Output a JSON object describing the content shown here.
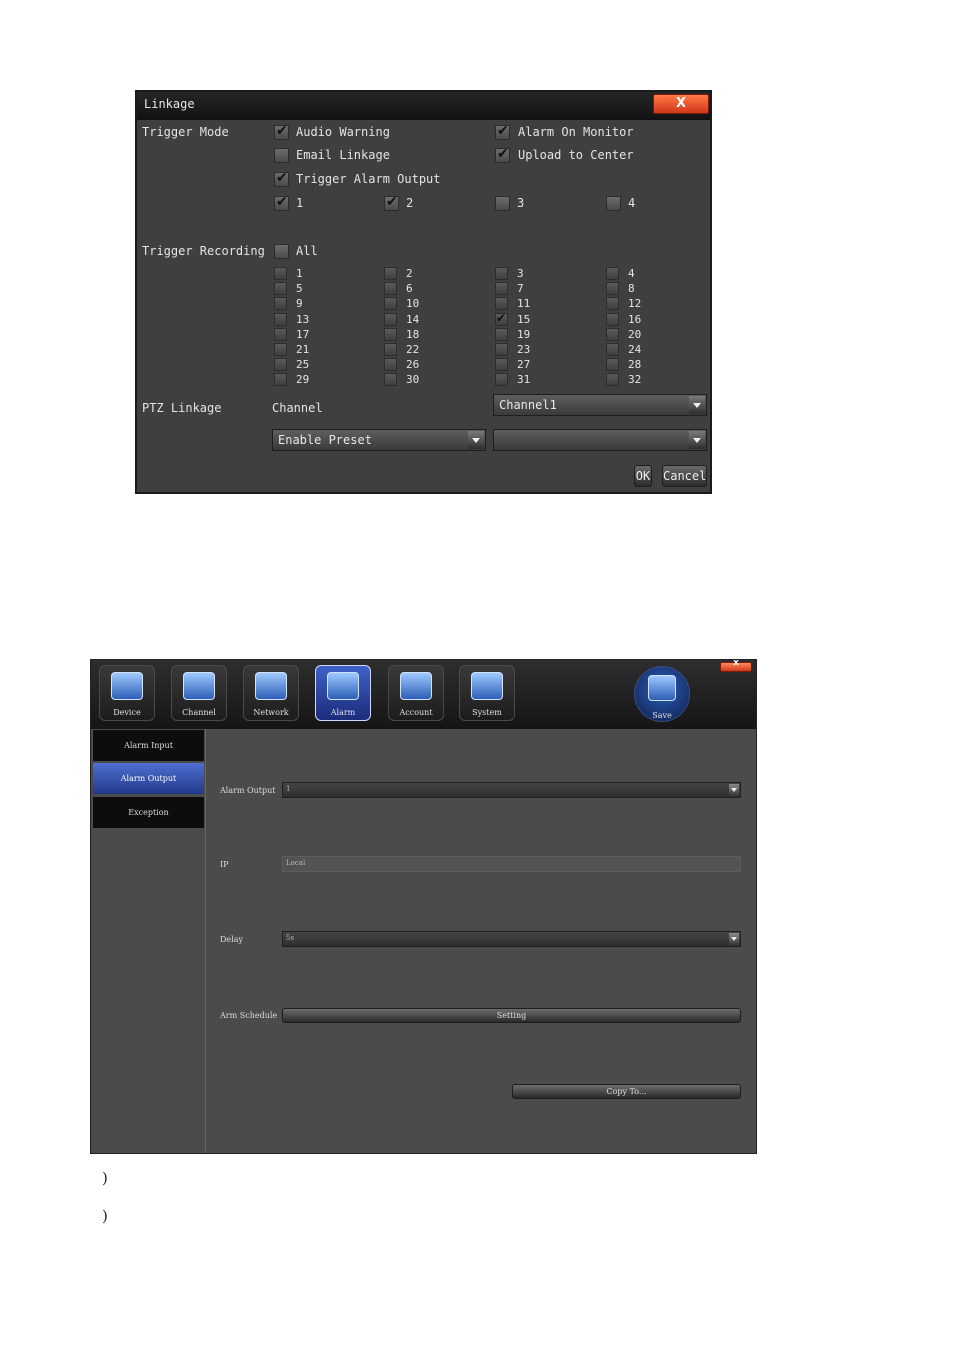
{
  "linkage": {
    "title": "Linkage",
    "close_label": "X",
    "trigger_mode": {
      "label": "Trigger Mode",
      "options": [
        {
          "label": "Audio Warning",
          "checked": true
        },
        {
          "label": "Alarm On Monitor",
          "checked": true
        },
        {
          "label": "Email Linkage",
          "checked": false
        },
        {
          "label": "Upload to Center",
          "checked": true
        },
        {
          "label": "Trigger Alarm Output",
          "checked": true
        }
      ],
      "outputs": [
        {
          "label": "1",
          "checked": true
        },
        {
          "label": "2",
          "checked": true
        },
        {
          "label": "3",
          "checked": false
        },
        {
          "label": "4",
          "checked": false
        }
      ]
    },
    "trigger_recording": {
      "label": "Trigger Recording",
      "all_label": "All",
      "all_checked": false,
      "channels": [
        "1",
        "2",
        "3",
        "4",
        "5",
        "6",
        "7",
        "8",
        "9",
        "10",
        "11",
        "12",
        "13",
        "14",
        "15",
        "16",
        "17",
        "18",
        "19",
        "20",
        "21",
        "22",
        "23",
        "24",
        "25",
        "26",
        "27",
        "28",
        "29",
        "30",
        "31",
        "32"
      ],
      "checked_channels": [
        "15"
      ]
    },
    "ptz": {
      "label": "PTZ Linkage",
      "channel_label": "Channel",
      "channel_value": "Channel1",
      "preset_value": "Enable Preset",
      "preset_number_value": ""
    },
    "ok_label": "OK",
    "cancel_label": "Cancel"
  },
  "alarm_window": {
    "close_label": "x",
    "toolbar": [
      {
        "label": "Device",
        "icon": "device-icon",
        "active": false
      },
      {
        "label": "Channel",
        "icon": "channel-icon",
        "active": false
      },
      {
        "label": "Network",
        "icon": "network-icon",
        "active": false
      },
      {
        "label": "Alarm",
        "icon": "alarm-icon",
        "active": true
      },
      {
        "label": "Account",
        "icon": "account-icon",
        "active": false
      },
      {
        "label": "System",
        "icon": "system-icon",
        "active": false
      }
    ],
    "save_label": "Save",
    "sidebar": [
      {
        "label": "Alarm Input",
        "active": false
      },
      {
        "label": "Alarm Output",
        "active": true
      },
      {
        "label": "Exception",
        "active": false
      }
    ],
    "form": {
      "alarm_output_label": "Alarm Output",
      "alarm_output_value": "1",
      "ip_label": "IP",
      "ip_value": "Local",
      "delay_label": "Delay",
      "delay_value": "5s",
      "arm_schedule_label": "Arm Schedule",
      "setting_label": "Setting",
      "copy_label": "Copy To..."
    }
  },
  "footnotes": [
    ")",
    ")"
  ]
}
